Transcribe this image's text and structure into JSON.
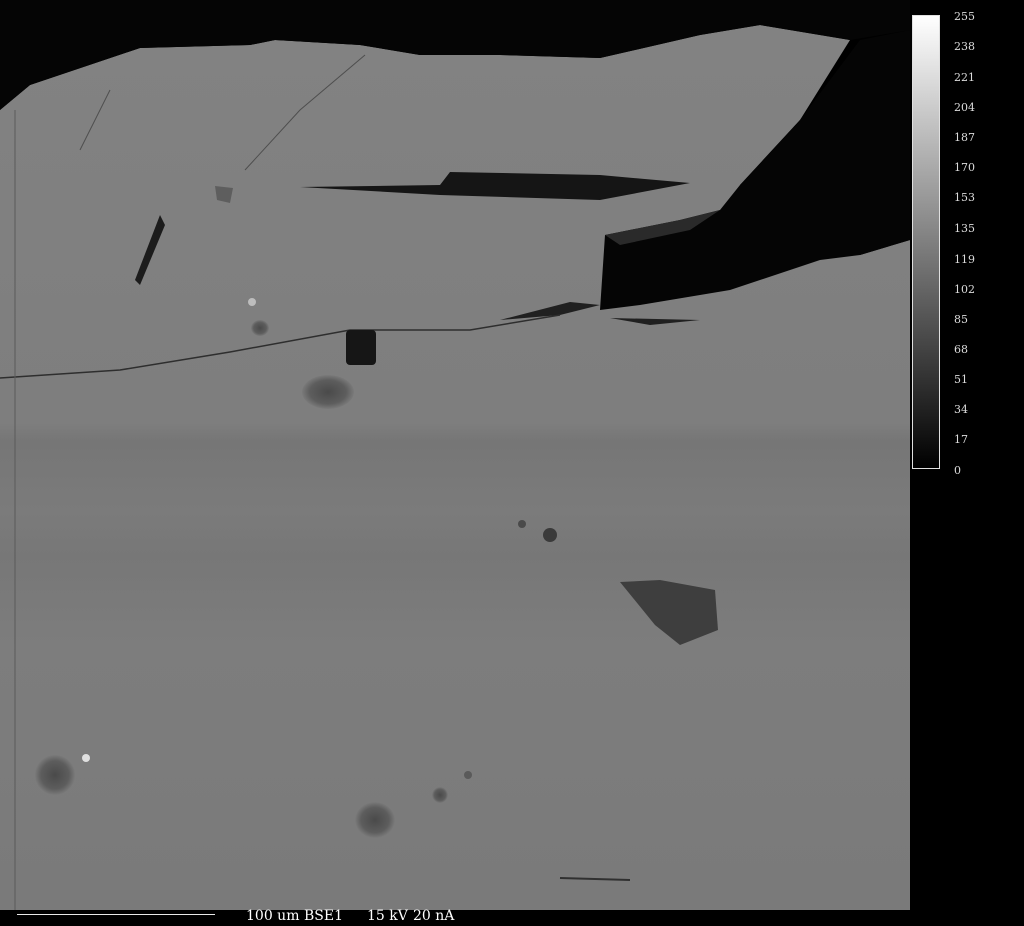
{
  "colorbar": {
    "ticks": [
      "255",
      "238",
      "221",
      "204",
      "187",
      "170",
      "153",
      "135",
      "119",
      "102",
      "85",
      "68",
      "51",
      "34",
      "17",
      "0"
    ]
  },
  "footer": {
    "scale": "100 um",
    "detector": "BSE1",
    "voltage": "15 kV",
    "current": "20 nA"
  }
}
